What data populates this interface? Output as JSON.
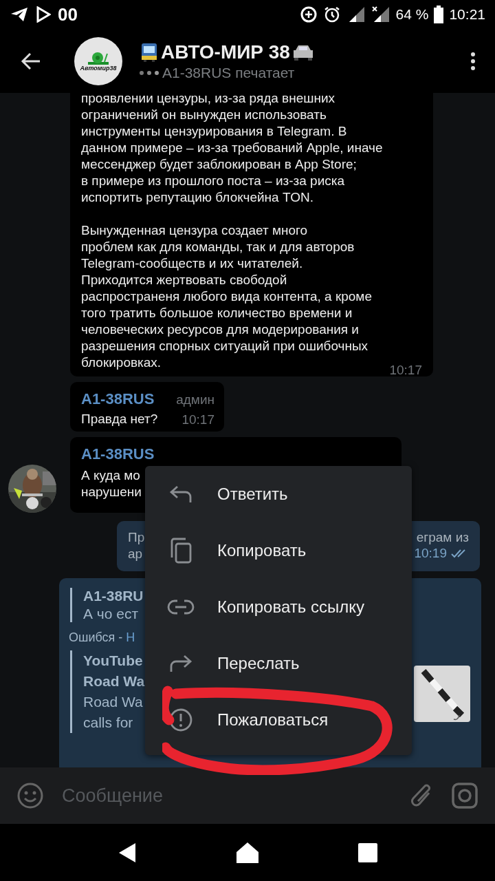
{
  "status_bar": {
    "app_text": "00",
    "battery": "64 %",
    "time": "10:21"
  },
  "header": {
    "logo_text": "Автомир38",
    "title": "АВТО-МИР 38",
    "subtitle": "A1-38RUS печатает"
  },
  "messages": [
    {
      "kind": "long",
      "paragraphs": [
        "проявлении цензуры, из-за ряда внешних\nограничений он вынужден использовать\nинструменты цензурирования в Telegram. В\nданном примере – из-за требований Apple, иначе\nмессенджер будет заблокирован в App Store;\nв примере из прошлого поста – из-за риска\nиспортить репутацию блокчейна TON.",
        "Вынужденная цензура создает много\nпроблем как для команды, так и для авторов\nTelegram-сообществ и их читателей.\nПриходится жертвовать свободой\nраспространеня любого вида контента, а кроме\nтого тратить большое количество времени и\nчеловеческих ресурсов для модерирования и\nразрешения спорных ситуаций при ошибочных\nблокировках."
      ],
      "time": "10:17"
    },
    {
      "kind": "admin",
      "author": "A1-38RUS",
      "badge": "админ",
      "text": "Правда нет?",
      "time": "10:17"
    },
    {
      "kind": "admin_avatar",
      "author": "A1-38RUS",
      "text": "А куда мо\nнарушени"
    },
    {
      "kind": "outgoing",
      "left_text": "Пр\nар",
      "right_text": "еграм из",
      "time": "10:19",
      "read": true
    },
    {
      "kind": "reply",
      "quote_author": "A1-38RU",
      "quote_text": "А чо ест",
      "sender": "Ошибся - ",
      "link": "Н",
      "preview": {
        "site": "YouTube",
        "title": "Road Wa",
        "text": "Road Wa\ncalls for"
      }
    }
  ],
  "context_menu": [
    {
      "kind": "reply",
      "label": "Ответить"
    },
    {
      "kind": "copy",
      "label": "Копировать"
    },
    {
      "kind": "link",
      "label": "Копировать ссылку"
    },
    {
      "kind": "forward",
      "label": "Переслать"
    },
    {
      "kind": "report",
      "label": "Пожаловаться"
    }
  ],
  "input": {
    "placeholder": "Сообщение"
  }
}
